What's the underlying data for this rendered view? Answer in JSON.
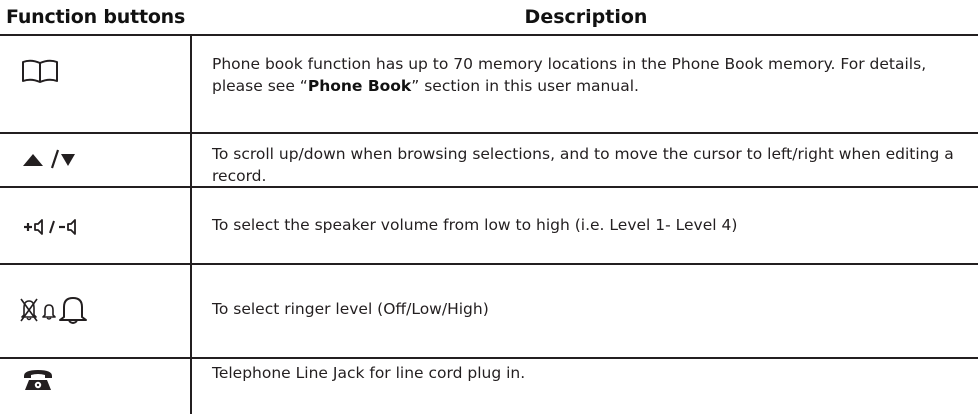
{
  "table": {
    "headers": {
      "function": "Function buttons",
      "description": "Description"
    },
    "rows": [
      {
        "icon": "book-icon",
        "description_pre": "Phone book function has up to 70 memory locations in the Phone Book memory. For details, please see “",
        "description_bold": "Phone Book",
        "description_post": "” section in this user manual."
      },
      {
        "icon": "up-down-arrows-icon",
        "description": "To scroll up/down when browsing selections, and to move the cursor to left/right when editing a record."
      },
      {
        "icon": "speaker-volume-icon",
        "description": "To select the speaker volume from low to high (i.e. Level 1- Level 4)"
      },
      {
        "icon": "ringer-levels-icon",
        "description": "To select ringer level (Off/Low/High)"
      },
      {
        "icon": "telephone-icon",
        "description": "Telephone Line Jack for line cord plug in."
      }
    ]
  }
}
